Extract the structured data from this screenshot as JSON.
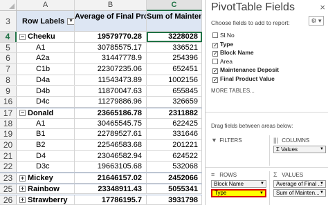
{
  "sheet": {
    "columns": [
      "A",
      "B",
      "C"
    ],
    "header_row": {
      "row_num": "3",
      "a": "Row Labels",
      "b": "Average of Final Product Value",
      "c": "Sum of Maintenance Deposit"
    },
    "rows": [
      {
        "row_num": "4",
        "a": "Cheeku",
        "b": "19579770.28",
        "c": "3228028",
        "type": "group",
        "toggle": "−"
      },
      {
        "row_num": "5",
        "a": "A1",
        "b": "30785575.17",
        "c": "336521",
        "type": "item"
      },
      {
        "row_num": "6",
        "a": "A2a",
        "b": "31447778.9",
        "c": "254396",
        "type": "item"
      },
      {
        "row_num": "7",
        "a": "C1b",
        "b": "22307235.06",
        "c": "652451",
        "type": "item"
      },
      {
        "row_num": "8",
        "a": "D4a",
        "b": "11543473.89",
        "c": "1002156",
        "type": "item"
      },
      {
        "row_num": "9",
        "a": "D4b",
        "b": "11870047.63",
        "c": "655845",
        "type": "item"
      },
      {
        "row_num": "16",
        "a": "D4c",
        "b": "11279886.96",
        "c": "326659",
        "type": "item"
      },
      {
        "row_num": "17",
        "a": "Donald",
        "b": "23665186.78",
        "c": "2311882",
        "type": "group",
        "toggle": "−"
      },
      {
        "row_num": "18",
        "a": "A1",
        "b": "30465545.75",
        "c": "622425",
        "type": "item"
      },
      {
        "row_num": "19",
        "a": "B1",
        "b": "22789527.61",
        "c": "331646",
        "type": "item"
      },
      {
        "row_num": "20",
        "a": "B2",
        "b": "22546583.68",
        "c": "201221",
        "type": "item"
      },
      {
        "row_num": "21",
        "a": "D4",
        "b": "23046582.94",
        "c": "624522",
        "type": "item"
      },
      {
        "row_num": "22",
        "a": "D3c",
        "b": "19663105.68",
        "c": "532068",
        "type": "item"
      },
      {
        "row_num": "23",
        "a": "Mickey",
        "b": "21646157.02",
        "c": "2452066",
        "type": "group",
        "toggle": "+"
      },
      {
        "row_num": "25",
        "a": "Rainbow",
        "b": "23348911.43",
        "c": "5055341",
        "type": "group",
        "toggle": "+"
      },
      {
        "row_num": "26",
        "a": "Strawberry",
        "b": "17786195.7",
        "c": "3931798",
        "type": "group",
        "toggle": "+"
      }
    ]
  },
  "pane": {
    "title": "PivotTable Fields",
    "close": "×",
    "choose_label": "Choose fields to add to report:",
    "gear": "⚙ ▾",
    "fields": [
      {
        "label": "Sl.No",
        "checked": false
      },
      {
        "label": "Type",
        "checked": true
      },
      {
        "label": "Block Name",
        "checked": true
      },
      {
        "label": "Area",
        "checked": false
      },
      {
        "label": "Maintenance Deposit",
        "checked": true
      },
      {
        "label": "Final Product Value",
        "checked": true
      }
    ],
    "more_tables": "MORE TABLES...",
    "drag_label": "Drag fields between areas below:",
    "filters_label": "FILTERS",
    "columns_label": "COLUMNS",
    "columns_chip": "Σ  Values",
    "rows_label": "ROWS",
    "values_label": "VALUES",
    "rows_chips": [
      "Block Name",
      "Type"
    ],
    "values_chips": [
      "Average of Final ...",
      "Sum of Mainten..."
    ],
    "filter_icon": "▼",
    "columns_icon": "|||",
    "rows_icon": "≡",
    "values_icon": "Σ"
  }
}
